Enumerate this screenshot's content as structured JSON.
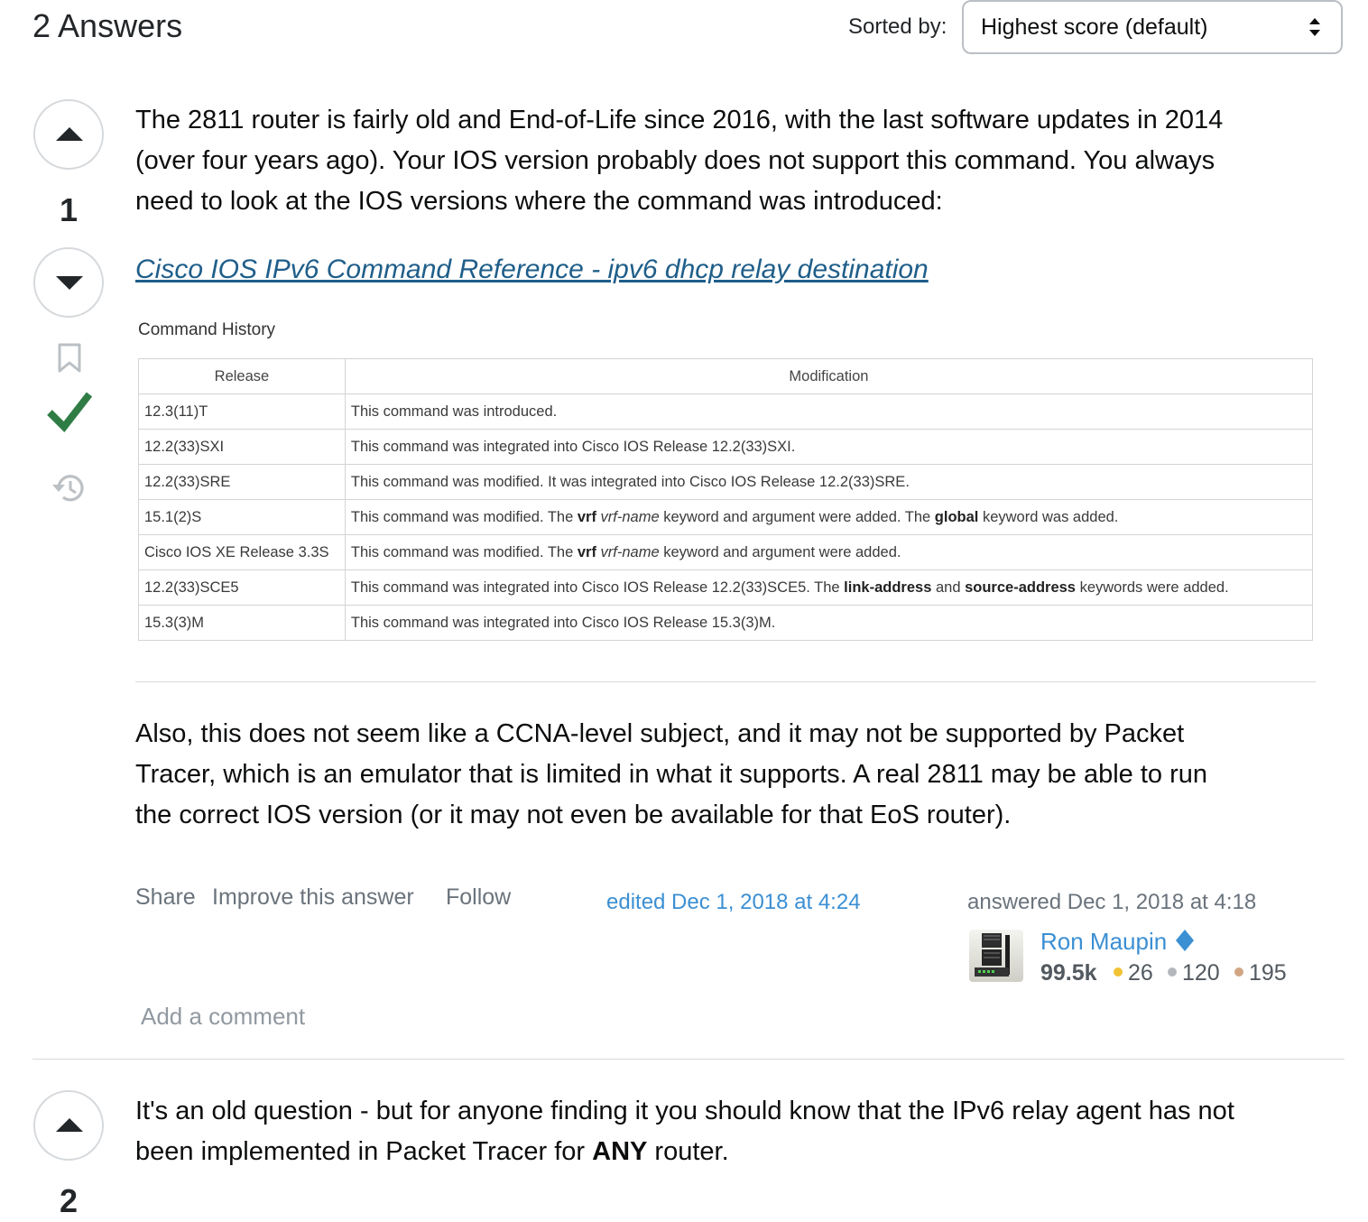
{
  "header": {
    "answers_count": "2 Answers",
    "sorted_by_label": "Sorted by:",
    "sort_value": "Highest score (default)"
  },
  "answer1": {
    "vote_count": "1",
    "para1_line1": "The 2811 router is fairly old and End-of-Life since 2016, with the last software updates in 2014",
    "para1_line2": "(over four years ago). Your IOS version probably does not support this command. You always",
    "para1_line3": "need to look at the IOS versions where the command was introduced:",
    "link_text": "Cisco IOS IPv6 Command Reference - ipv6 dhcp relay destination",
    "command_history": {
      "title": "Command History",
      "headers": [
        "Release",
        "Modification"
      ],
      "rows": [
        {
          "release": "12.3(11)T",
          "mod": "This command was introduced."
        },
        {
          "release": "12.2(33)SXI",
          "mod": "This command was integrated into Cisco IOS Release 12.2(33)SXI."
        },
        {
          "release": "12.2(33)SRE",
          "mod": "This command was modified. It was integrated into Cisco IOS Release 12.2(33)SRE."
        },
        {
          "release": "15.1(2)S",
          "mod_a": "This command was modified. The ",
          "mod_b1": "vrf",
          "mod_c": " ",
          "mod_i": "vrf-name",
          "mod_d": " keyword and argument were added. The ",
          "mod_b2": "global",
          "mod_e": " keyword was added."
        },
        {
          "release": "Cisco IOS XE Release 3.3S",
          "mod_a": "This command was modified. The ",
          "mod_b1": "vrf",
          "mod_c": " ",
          "mod_i": "vrf-name",
          "mod_d": " keyword and argument were added."
        },
        {
          "release": "12.2(33)SCE5",
          "mod_a": "This command was integrated into Cisco IOS Release 12.2(33)SCE5. The ",
          "mod_b1": "link-address",
          "mod_c": " and ",
          "mod_b2": "source-address",
          "mod_d": " keywords were added."
        },
        {
          "release": "15.3(3)M",
          "mod": "This command was integrated into Cisco IOS Release 15.3(3)M."
        }
      ]
    },
    "para2_line1": "Also, this does not seem like a CCNA-level subject, and it may not be supported by Packet",
    "para2_line2": "Tracer, which is an emulator that is limited in what it supports. A real 2811 may be able to run",
    "para2_line3": "the correct IOS version (or it may not even be available for that EoS router).",
    "menu": {
      "share": "Share",
      "improve": "Improve this answer",
      "follow": "Follow"
    },
    "edited": "edited Dec 1, 2018 at 4:24",
    "answered": "answered Dec 1, 2018 at 4:18",
    "user": {
      "name": "Ron Maupin",
      "reputation": "99.5k",
      "gold": "26",
      "silver": "120",
      "bronze": "195"
    },
    "add_comment": "Add a comment"
  },
  "answer2": {
    "vote_count": "2",
    "line1": "It's an old question - but for anyone finding it you should know that the IPv6 relay agent has not",
    "line2_a": "been implemented in Packet Tracer for ",
    "line2_b": "ANY",
    "line2_c": " router."
  },
  "colors": {
    "link": "#1f5e8a",
    "accepted": "#2f7d45",
    "user_link": "#3b8fd3",
    "gold": "#f1c233",
    "silver": "#b4b8bc",
    "bronze": "#d1a684"
  },
  "icons": [
    "caret-up-icon",
    "caret-down-icon",
    "bookmark-icon",
    "checkmark-icon",
    "history-icon",
    "sort-arrows-icon",
    "diamond-icon"
  ]
}
